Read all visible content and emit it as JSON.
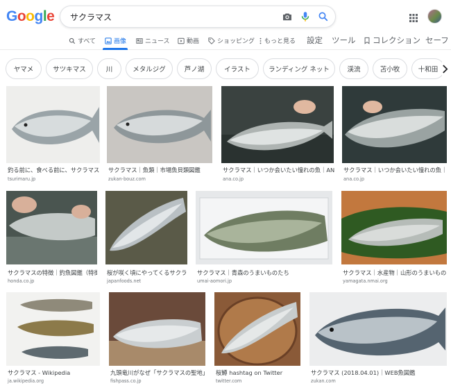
{
  "logo": [
    "G",
    "o",
    "o",
    "g",
    "l",
    "e"
  ],
  "colors": {
    "blue": "#4285f4",
    "red": "#ea4335",
    "yellow": "#fbbc05",
    "green": "#34a853",
    "accent": "#1a73e8"
  },
  "search": {
    "query": "サクラマス",
    "icons": [
      "camera-icon",
      "mic-icon",
      "search-icon"
    ]
  },
  "header": {
    "apps_icon": "grid-apps-icon",
    "avatar": "account-avatar"
  },
  "tabs": [
    {
      "label": "すべて",
      "icon": "search-icon"
    },
    {
      "label": "画像",
      "icon": "image-icon"
    },
    {
      "label": "ニュース",
      "icon": "news-icon"
    },
    {
      "label": "動画",
      "icon": "video-icon"
    },
    {
      "label": "ショッピング",
      "icon": "tag-icon"
    },
    {
      "label": "もっと見る",
      "icon": "more-icon"
    },
    {
      "label": "設定"
    },
    {
      "label": "ツール"
    },
    {
      "label": "コレクション",
      "icon": "bookmark-icon"
    },
    {
      "label": "セーフ"
    }
  ],
  "chips": [
    "ヤマメ",
    "サツキマス",
    "川",
    "メタルジグ",
    "芦ノ湖",
    "イラスト",
    "ランディング ネット",
    "渓流",
    "苫小牧",
    "十和田"
  ],
  "results": [
    {
      "title": "釣る前に、食べる前に、サクラマス...",
      "source": "tsurimaru.jp"
    },
    {
      "title": "サクラマス｜魚類｜市場魚貝類図鑑",
      "source": "zukan-bouz.com"
    },
    {
      "title": "サクラマス｜いつか会いたい憧れの魚｜ANA...",
      "source": "ana.co.jp"
    },
    {
      "title": "サクラマス｜いつか会いたい憧れの魚｜...",
      "source": "ana.co.jp"
    },
    {
      "title": "サクラマスの特徴｜釣魚図鑑（特徴...",
      "source": "honda.co.jp"
    },
    {
      "title": "桜が咲く頃にやってくるサクラ...",
      "source": "japanfoods.net"
    },
    {
      "title": "サクラマス｜青森のうまいものたち",
      "source": "umai-aomori.jp"
    },
    {
      "title": "サクラマス｜水産物｜山形のうまいもの...",
      "source": "yamagata.nmai.org"
    },
    {
      "title": "サクラマス - Wikipedia",
      "source": "ja.wikipedia.org"
    },
    {
      "title": "九頭竜川がなぜ「サクラマスの聖地」...",
      "source": "fishpass.co.jp"
    },
    {
      "title": "桜鱒 hashtag on Twitter",
      "source": "twitter.com"
    },
    {
      "title": "サクラマス (2018.04.01)｜WEB魚図鑑",
      "source": "zukan.com"
    }
  ]
}
